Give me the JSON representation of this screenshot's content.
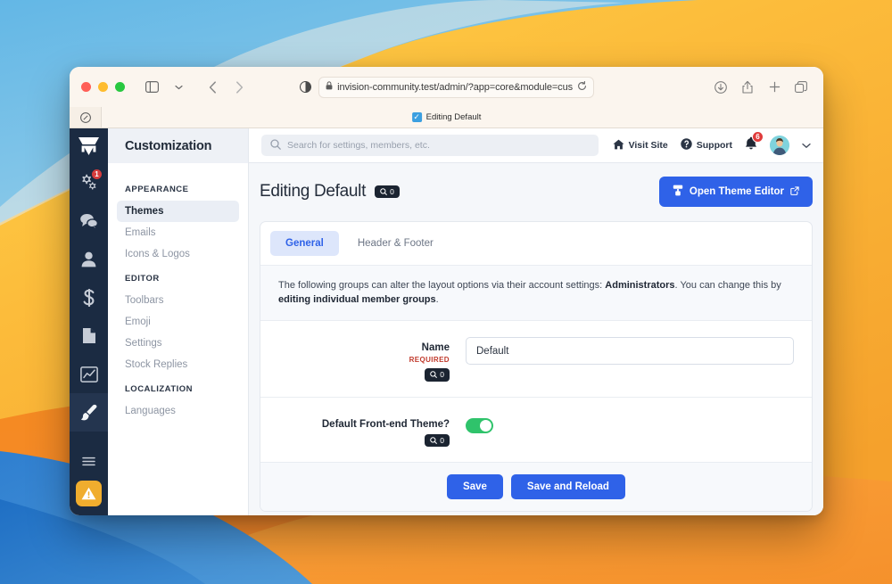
{
  "browser": {
    "url": "invision-community.test/admin/?app=core&module=customization",
    "tab_title": "Editing Default",
    "traffic_lights": [
      "close",
      "minimize",
      "zoom"
    ],
    "toolbar_icons": [
      "sidebar-toggle",
      "sidebar-dropdown",
      "back",
      "forward",
      "reader-view",
      "downloads",
      "share",
      "new-tab",
      "tab-overview"
    ]
  },
  "rail": {
    "logo": "invision-community-logo",
    "items": [
      {
        "icon": "gears-icon",
        "badge": "1"
      },
      {
        "icon": "chat-bubbles-icon",
        "badge": ""
      },
      {
        "icon": "person-icon",
        "badge": ""
      },
      {
        "icon": "dollar-icon",
        "badge": ""
      },
      {
        "icon": "document-icon",
        "badge": ""
      },
      {
        "icon": "chart-line-icon",
        "badge": ""
      },
      {
        "icon": "paintbrush-icon",
        "badge": ""
      }
    ],
    "menu_icon": "hamburger-icon",
    "warning_icon": "warning-triangle-icon"
  },
  "sidebar": {
    "title": "Customization",
    "groups": [
      {
        "label": "APPEARANCE",
        "items": [
          {
            "label": "Themes",
            "active": true
          },
          {
            "label": "Emails",
            "active": false
          },
          {
            "label": "Icons & Logos",
            "active": false
          }
        ]
      },
      {
        "label": "EDITOR",
        "items": [
          {
            "label": "Toolbars",
            "active": false
          },
          {
            "label": "Emoji",
            "active": false
          },
          {
            "label": "Settings",
            "active": false
          },
          {
            "label": "Stock Replies",
            "active": false
          }
        ]
      },
      {
        "label": "LOCALIZATION",
        "items": [
          {
            "label": "Languages",
            "active": false
          }
        ]
      }
    ]
  },
  "topbar": {
    "search_placeholder": "Search for settings, members, etc.",
    "search_value": "",
    "visit_site": "Visit Site",
    "support": "Support",
    "notification_count": "6"
  },
  "page": {
    "title": "Editing Default",
    "title_badge": "0",
    "primary_button": "Open Theme Editor"
  },
  "tabs": [
    {
      "label": "General",
      "active": true
    },
    {
      "label": "Header & Footer",
      "active": false
    }
  ],
  "notice": {
    "part1": "The following groups can alter the layout options via their account settings:",
    "group": "Administrators",
    "part2": ". You can change this by",
    "link": "editing individual member groups",
    "part3": "."
  },
  "form": {
    "name": {
      "label": "Name",
      "required": "REQUIRED",
      "badge": "0",
      "value": "Default"
    },
    "default_theme": {
      "label": "Default Front-end Theme?",
      "badge": "0",
      "enabled": true
    }
  },
  "footer": {
    "save": "Save",
    "save_reload": "Save and Reload"
  },
  "colors": {
    "accent": "#2f62e8",
    "rail": "#1b2b42",
    "toggle_on": "#2fc36b",
    "danger": "#d63c3c",
    "warning": "#f0ad2e"
  }
}
